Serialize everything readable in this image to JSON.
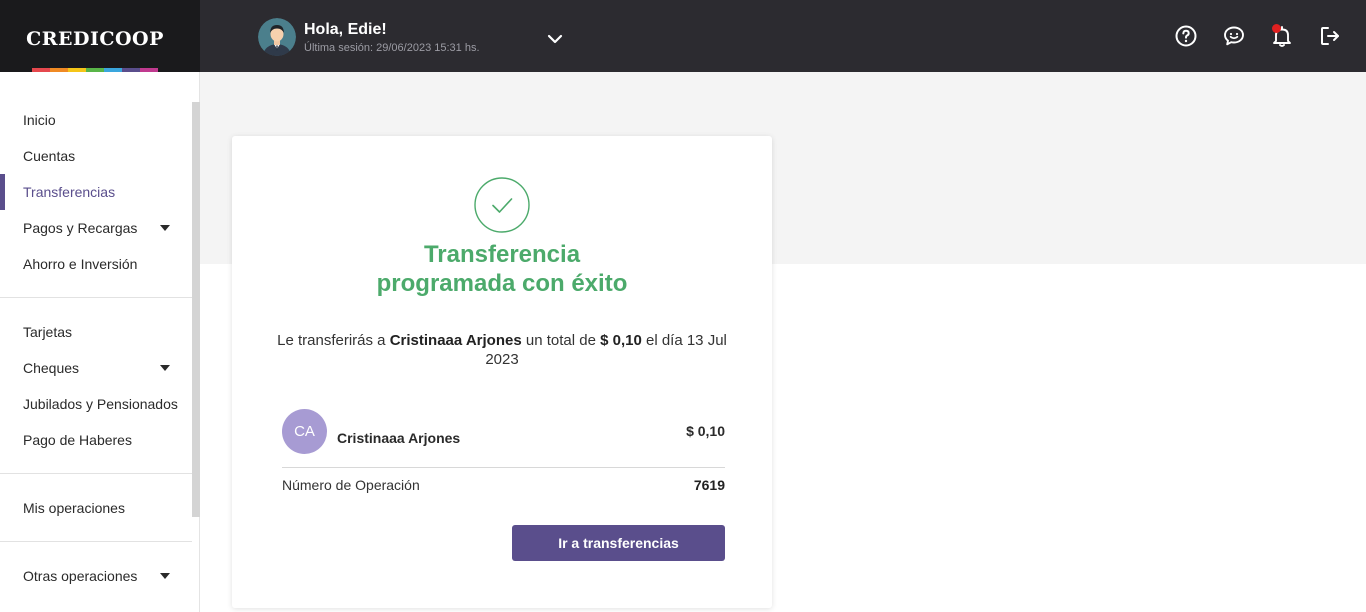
{
  "brand": {
    "name": "CREDICOOP",
    "stripe_colors": [
      "#e5484d",
      "#f08a24",
      "#f5c518",
      "#59b548",
      "#3aa6dd",
      "#5a4e8c",
      "#c03a8f"
    ]
  },
  "header": {
    "greeting": "Hola, Edie!",
    "last_session": "Última sesión: 29/06/2023 15:31 hs.",
    "icons": [
      "help-icon",
      "chat-icon",
      "bell-icon",
      "logout-icon"
    ]
  },
  "sidebar": {
    "group1": [
      {
        "label": "Inicio",
        "caret": false
      },
      {
        "label": "Cuentas",
        "caret": false
      },
      {
        "label": "Transferencias",
        "caret": false,
        "active": true
      },
      {
        "label": "Pagos y Recargas",
        "caret": true
      },
      {
        "label": "Ahorro e Inversión",
        "caret": false
      }
    ],
    "group2": [
      {
        "label": "Tarjetas",
        "caret": false
      },
      {
        "label": "Cheques",
        "caret": true
      },
      {
        "label": "Jubilados y Pensionados",
        "caret": false
      },
      {
        "label": "Pago de Haberes",
        "caret": false
      }
    ],
    "group3": [
      {
        "label": "Mis operaciones",
        "caret": false
      }
    ],
    "group4": [
      {
        "label": "Otras operaciones",
        "caret": true
      }
    ]
  },
  "card": {
    "title_line1": "Transferencia",
    "title_line2": "programada con éxito",
    "summary": {
      "prefix": "Le transferirás a ",
      "name": "Cristinaaa Arjones",
      "middle": " un total de ",
      "amount": "$ 0,10",
      "suffix": " el día 13 Jul 2023"
    },
    "recipient": {
      "initials": "CA",
      "name": "Cristinaaa Arjones",
      "amount": "$ 0,10"
    },
    "operation": {
      "label": "Número de Operación",
      "value": "7619"
    },
    "button_label": "Ir a transferencias"
  },
  "colors": {
    "accent": "#5a4e8c",
    "success": "#4caa6b",
    "avatar_initials_bg": "#a79bd3"
  }
}
